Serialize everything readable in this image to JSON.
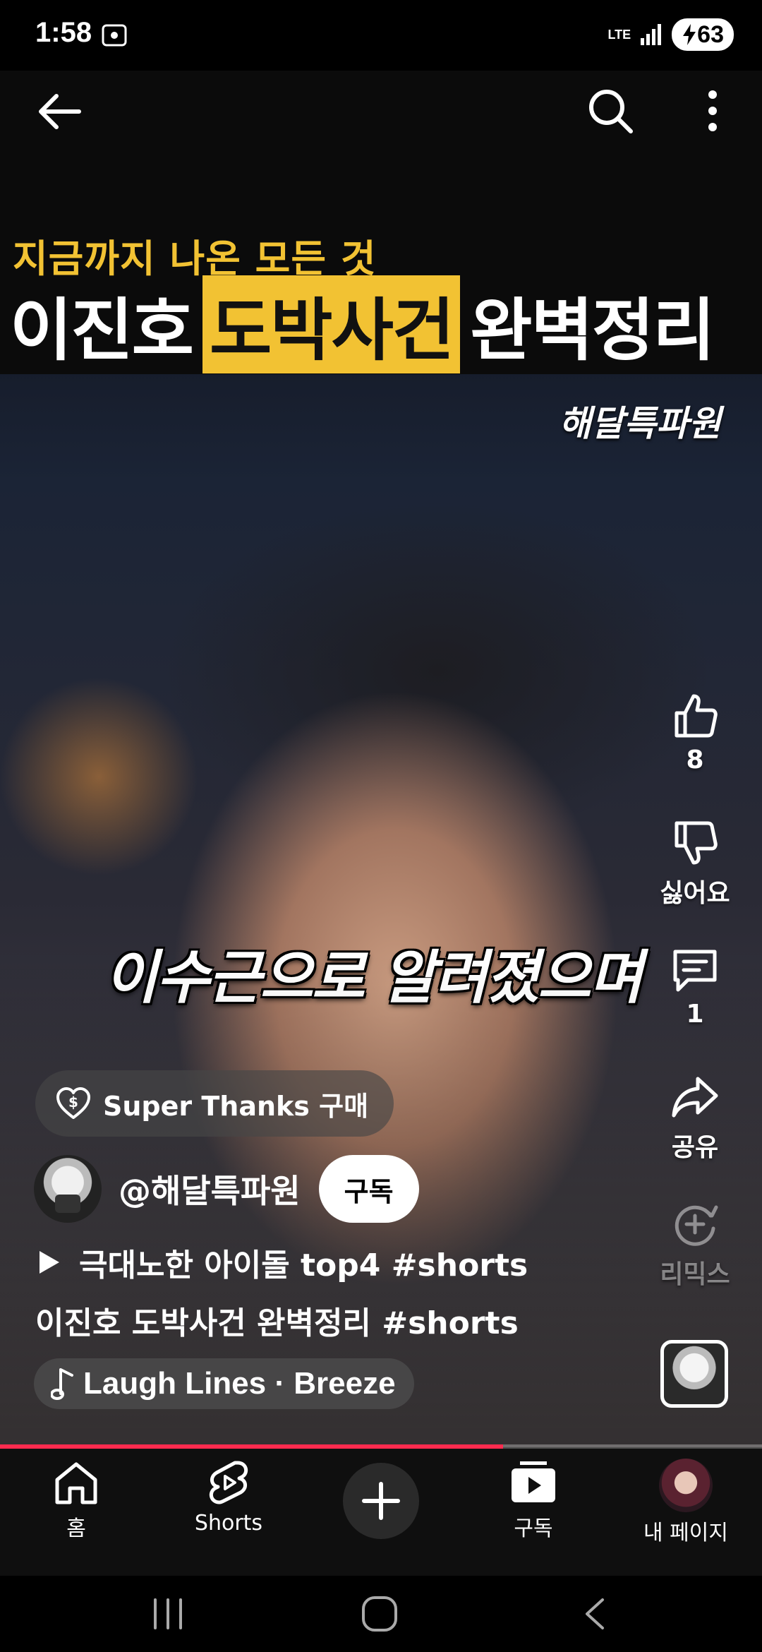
{
  "status_bar": {
    "time": "1:58",
    "network": "LTE",
    "battery": "63"
  },
  "video": {
    "headline_small": "지금까지 나온 모든 것",
    "headline_part1": "이진호",
    "headline_highlight": "도박사건",
    "headline_part2": "완벽정리",
    "watermark": "해달특파원",
    "subtitle": "이수근으로 알려졌으며",
    "progress_fraction": 0.66
  },
  "actions": {
    "like_count": "8",
    "dislike_label": "싫어요",
    "comment_count": "1",
    "share_label": "공유",
    "remix_label": "리믹스"
  },
  "super_thanks": {
    "label": "Super Thanks 구매"
  },
  "channel": {
    "name": "@해달특파원",
    "subscribe_label": "구독"
  },
  "related_video": "극대노한 아이돌 top4 #shorts",
  "title": "이진호 도박사건 완벽정리 #shorts",
  "music": "Laugh Lines · Breeze",
  "bottom_nav": {
    "home": "홈",
    "shorts": "Shorts",
    "subscriptions": "구독",
    "my_page": "내 페이지"
  },
  "colors": {
    "accent_red": "#ff2b4f",
    "headline_yellow": "#f2c233"
  },
  "icons": [
    "back-arrow-icon",
    "search-icon",
    "more-vert-icon",
    "thumbs-up-icon",
    "thumbs-down-icon",
    "comment-icon",
    "share-icon",
    "remix-icon",
    "heart-dollar-icon",
    "play-icon",
    "music-note-icon",
    "home-icon",
    "shorts-icon",
    "plus-icon",
    "subscriptions-icon"
  ]
}
